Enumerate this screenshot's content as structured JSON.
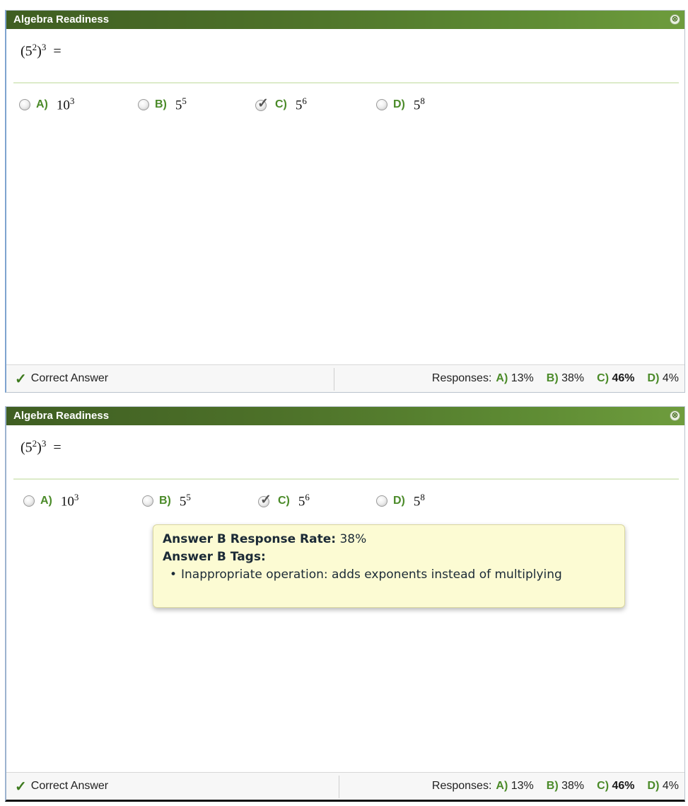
{
  "panels": [
    {
      "title": "Algebra Readiness",
      "close_glyph": "⊗",
      "question": {
        "base": "5",
        "inner_exp": "2",
        "outer_exp": "3",
        "equals": "="
      },
      "options": [
        {
          "letter": "A)",
          "base": "10",
          "exp": "3",
          "correct": false
        },
        {
          "letter": "B)",
          "base": "5",
          "exp": "5",
          "correct": false
        },
        {
          "letter": "C)",
          "base": "5",
          "exp": "6",
          "correct": true
        },
        {
          "letter": "D)",
          "base": "5",
          "exp": "8",
          "correct": false
        }
      ],
      "footer": {
        "correct_label": "Correct Answer",
        "responses_label": "Responses:",
        "responses": [
          {
            "letter": "A)",
            "value": "13%"
          },
          {
            "letter": "B)",
            "value": "38%"
          },
          {
            "letter": "C)",
            "value": "46%"
          },
          {
            "letter": "D)",
            "value": "4%"
          }
        ]
      }
    },
    {
      "title": "Algebra Readiness",
      "close_glyph": "⊗",
      "question": {
        "base": "5",
        "inner_exp": "2",
        "outer_exp": "3",
        "equals": "="
      },
      "options": [
        {
          "letter": "A)",
          "base": "10",
          "exp": "3",
          "correct": false
        },
        {
          "letter": "B)",
          "base": "5",
          "exp": "5",
          "correct": false
        },
        {
          "letter": "C)",
          "base": "5",
          "exp": "6",
          "correct": true
        },
        {
          "letter": "D)",
          "base": "5",
          "exp": "8",
          "correct": false
        }
      ],
      "tooltip": {
        "rate_label": "Answer B Response Rate:",
        "rate_value": "38%",
        "tags_label": "Answer B Tags:",
        "tags": [
          "Inappropriate operation: adds exponents instead of multiplying"
        ]
      },
      "footer": {
        "correct_label": "Correct Answer",
        "responses_label": "Responses:",
        "responses": [
          {
            "letter": "A)",
            "value": "13%"
          },
          {
            "letter": "B)",
            "value": "38%"
          },
          {
            "letter": "C)",
            "value": "46%"
          },
          {
            "letter": "D)",
            "value": "4%"
          }
        ]
      }
    }
  ],
  "icons": {
    "close": "close-circle-icon",
    "correct": "checkmark-icon",
    "radio": "radio-button"
  },
  "colors": {
    "accent_green": "#4a8a28",
    "titlebar_dark": "#3f5e22",
    "tooltip_bg": "#fcfbd3"
  }
}
